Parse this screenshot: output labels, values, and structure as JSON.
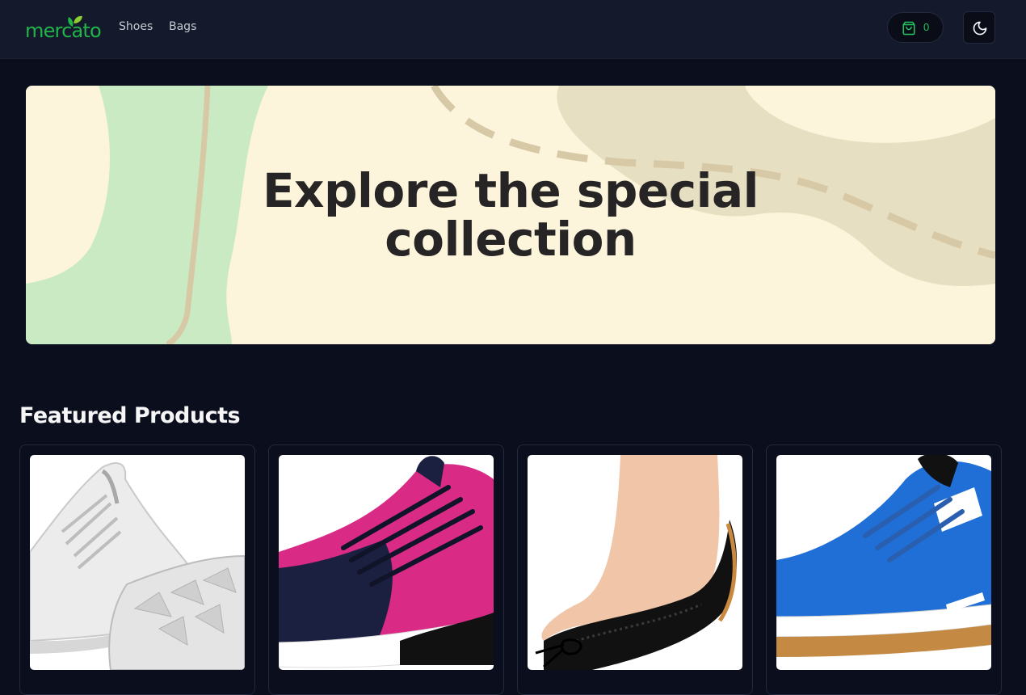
{
  "brand": {
    "name": "mercato",
    "accent": "#22b34a"
  },
  "nav": {
    "links": [
      {
        "label": "Shoes"
      },
      {
        "label": "Bags"
      }
    ]
  },
  "header_actions": {
    "cart": {
      "icon": "shopping-bag-icon",
      "count": "0"
    },
    "theme_toggle": {
      "icon": "moon-icon"
    }
  },
  "hero": {
    "title_line1": "Explore the special",
    "title_line2": "collection"
  },
  "featured": {
    "title": "Featured Products",
    "products": [
      {
        "image": "white-sneakers"
      },
      {
        "image": "pink-navy-knit-sneaker"
      },
      {
        "image": "black-lace-flat"
      },
      {
        "image": "blue-leather-sneaker"
      }
    ]
  }
}
